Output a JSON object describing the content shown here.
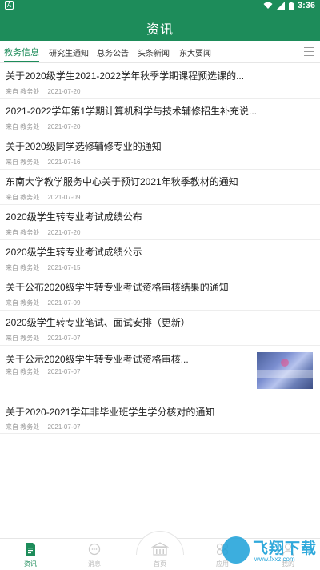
{
  "status_bar": {
    "left_icon": "A",
    "time": "3:36"
  },
  "app_bar": {
    "title": "资讯"
  },
  "tabs": [
    {
      "label": "教务信息",
      "active": true
    },
    {
      "label": "研究生通知",
      "active": false
    },
    {
      "label": "总务公告",
      "active": false
    },
    {
      "label": "头条新闻",
      "active": false
    },
    {
      "label": "东大要闻",
      "active": false
    }
  ],
  "articles": [
    {
      "title": "关于2020级学生2021-2022学年秋季学期课程预选课的...",
      "source_label": "来自",
      "source": "教务处",
      "date": "2021-07-20"
    },
    {
      "title": "2021-2022学年第1学期计算机科学与技术辅修招生补充说...",
      "source_label": "来自",
      "source": "教务处",
      "date": "2021-07-20"
    },
    {
      "title": "关于2020级同学选修辅修专业的通知",
      "source_label": "来自",
      "source": "教务处",
      "date": "2021-07-16"
    },
    {
      "title": "东南大学教学服务中心关于预订2021年秋季教材的通知",
      "source_label": "来自",
      "source": "教务处",
      "date": "2021-07-09"
    },
    {
      "title": "2020级学生转专业考试成绩公布",
      "source_label": "来自",
      "source": "教务处",
      "date": "2021-07-20"
    },
    {
      "title": "2020级学生转专业考试成绩公示",
      "source_label": "来自",
      "source": "教务处",
      "date": "2021-07-15"
    },
    {
      "title": "关于公布2020级学生转专业考试资格审核结果的通知",
      "source_label": "来自",
      "source": "教务处",
      "date": "2021-07-09"
    },
    {
      "title": "2020级学生转专业笔试、面试安排（更新）",
      "source_label": "来自",
      "source": "教务处",
      "date": "2021-07-07"
    },
    {
      "title": "关于公示2020级学生转专业考试资格审核...",
      "source_label": "来自",
      "source": "教务处",
      "date": "2021-07-07",
      "has_thumbnail": true
    },
    {
      "title": "关于2020-2021学年非毕业班学生学分核对的通知",
      "source_label": "来自",
      "source": "教务处",
      "date": "2021-07-07"
    }
  ],
  "bottom_nav": [
    {
      "label": "资讯",
      "icon": "document-icon",
      "active": true
    },
    {
      "label": "消息",
      "icon": "chat-icon",
      "active": false
    },
    {
      "label": "首页",
      "icon": "building-icon",
      "active": false
    },
    {
      "label": "应用",
      "icon": "apps-grid-icon",
      "active": false
    },
    {
      "label": "我的",
      "icon": "person-icon",
      "active": false
    }
  ],
  "watermark": {
    "text": "飞翔下载",
    "sub": "www.fxxz.com"
  },
  "colors": {
    "primary": "#1d8c5a",
    "meta_text": "#999999",
    "divider": "#ededed"
  }
}
